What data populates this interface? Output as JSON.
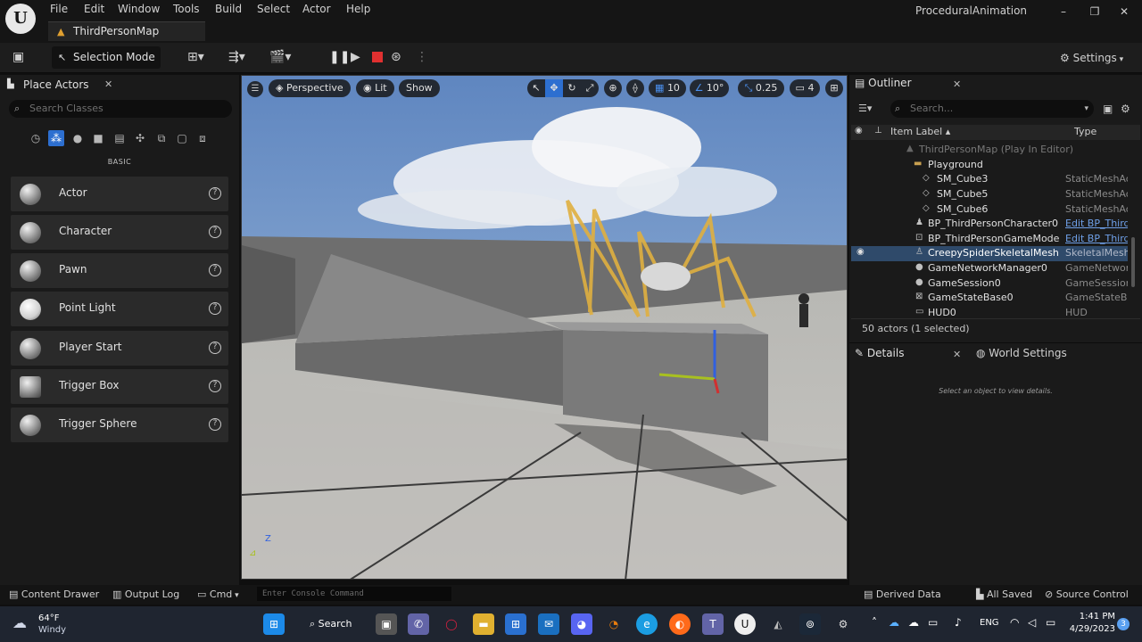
{
  "window": {
    "menu": [
      "File",
      "Edit",
      "Window",
      "Tools",
      "Build",
      "Select",
      "Actor",
      "Help"
    ],
    "map_tab": "ThirdPersonMap",
    "project_name": "ProceduralAnimation",
    "controls": [
      "–",
      "❐",
      "✕"
    ]
  },
  "toolbar": {
    "selection_mode": "Selection Mode",
    "settings_label": "Settings"
  },
  "place_actors": {
    "tab_label": "Place Actors",
    "search_placeholder": "Search Classes",
    "category_label": "BASIC",
    "items": [
      {
        "label": "Actor"
      },
      {
        "label": "Character"
      },
      {
        "label": "Pawn"
      },
      {
        "label": "Point Light"
      },
      {
        "label": "Player Start"
      },
      {
        "label": "Trigger Box"
      },
      {
        "label": "Trigger Sphere"
      }
    ]
  },
  "viewport": {
    "perspective_label": "Perspective",
    "lit_label": "Lit",
    "show_label": "Show",
    "grid_snap": "10",
    "rotation_snap": "10°",
    "scale_snap": "0.25",
    "camera_speed": "4",
    "axis_z": "Z"
  },
  "outliner": {
    "tab_label": "Outliner",
    "search_placeholder": "Search...",
    "col_label": "Item Label",
    "col_type": "Type",
    "rows": [
      {
        "label": "ThirdPersonMap (Play In Editor)",
        "type": "",
        "indent": 0,
        "dim": true
      },
      {
        "label": "Playground",
        "type": "",
        "indent": 1,
        "folder": true
      },
      {
        "label": "SM_Cube3",
        "type": "StaticMeshActor",
        "indent": 2
      },
      {
        "label": "SM_Cube5",
        "type": "StaticMeshActor",
        "indent": 2
      },
      {
        "label": "SM_Cube6",
        "type": "StaticMeshActor",
        "indent": 2
      },
      {
        "label": "BP_ThirdPersonCharacter0",
        "type": "Edit BP_ThirdPersonCharacter",
        "indent": 1,
        "link": true
      },
      {
        "label": "BP_ThirdPersonGameMode0",
        "type": "Edit BP_ThirdPersonGameMode",
        "indent": 1,
        "link": true
      },
      {
        "label": "CreepySpiderSkeletalMesh",
        "type": "SkeletalMeshActor",
        "indent": 1,
        "selected": true
      },
      {
        "label": "GameNetworkManager0",
        "type": "GameNetworkManager",
        "indent": 1
      },
      {
        "label": "GameSession0",
        "type": "GameSession",
        "indent": 1
      },
      {
        "label": "GameStateBase0",
        "type": "GameStateBase",
        "indent": 1
      },
      {
        "label": "HUD0",
        "type": "HUD",
        "indent": 1
      }
    ],
    "actor_count": "50 actors (1 selected)"
  },
  "details": {
    "tab_label": "Details",
    "world_settings_label": "World Settings",
    "empty_message": "Select an object to view details."
  },
  "bottom_bar": {
    "content_drawer": "Content Drawer",
    "output_log": "Output Log",
    "cmd": "Cmd",
    "console_placeholder": "Enter Console Command",
    "derived_data": "Derived Data",
    "all_saved": "All Saved",
    "source_control": "Source Control"
  },
  "taskbar": {
    "temperature": "64°F",
    "weather": "Windy",
    "search_label": "Search",
    "language": "ENG",
    "time": "1:41 PM",
    "date": "4/29/2023",
    "notification_count": "3"
  }
}
